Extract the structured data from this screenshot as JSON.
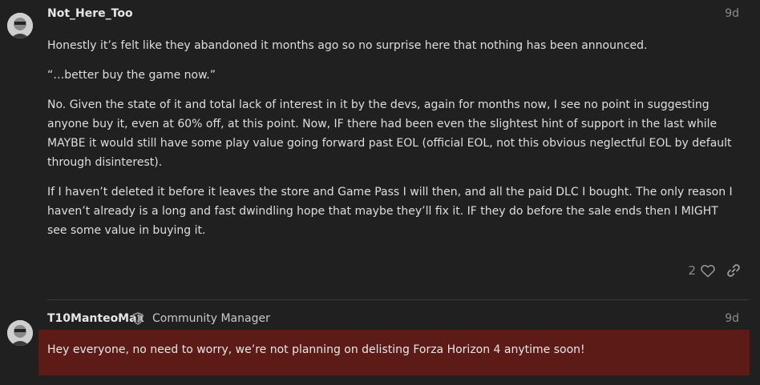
{
  "posts": [
    {
      "username": "Not_Here_Too",
      "date": "9d",
      "paragraphs": [
        "Honestly it’s felt like they abandoned it months ago so no surprise here that nothing has been announced.",
        "“…better buy the game now.”",
        "No. Given the state of it and total lack of interest in it by the devs, again for months now, I see no point in suggesting anyone buy it, even at 60% off, at this point. Now, IF there had been even the slightest hint of support in the last while MAYBE it would still have some play value going forward past EOL (official EOL, not this obvious neglectful EOL by default through disinterest).",
        "If I haven’t deleted it before it leaves the store and Game Pass I will then, and all the paid DLC I bought. The only reason I haven’t already is a long and fast dwindling hope that maybe they’ll fix it. IF they do before the sale ends then I MIGHT see some value in buying it."
      ],
      "like_count": "2",
      "icons": {
        "like": "heart-icon",
        "share": "link-icon"
      }
    },
    {
      "username": "T10ManteoMax",
      "role": "Community Manager",
      "date": "9d",
      "text": "Hey everyone, no need to worry, we’re not planning on delisting Forza Horizon 4 anytime soon!",
      "icons": {
        "badge": "shield-icon"
      }
    }
  ],
  "colors": {
    "background": "#202020",
    "highlight": "#5c1b16",
    "muted": "#8c8c8c"
  }
}
